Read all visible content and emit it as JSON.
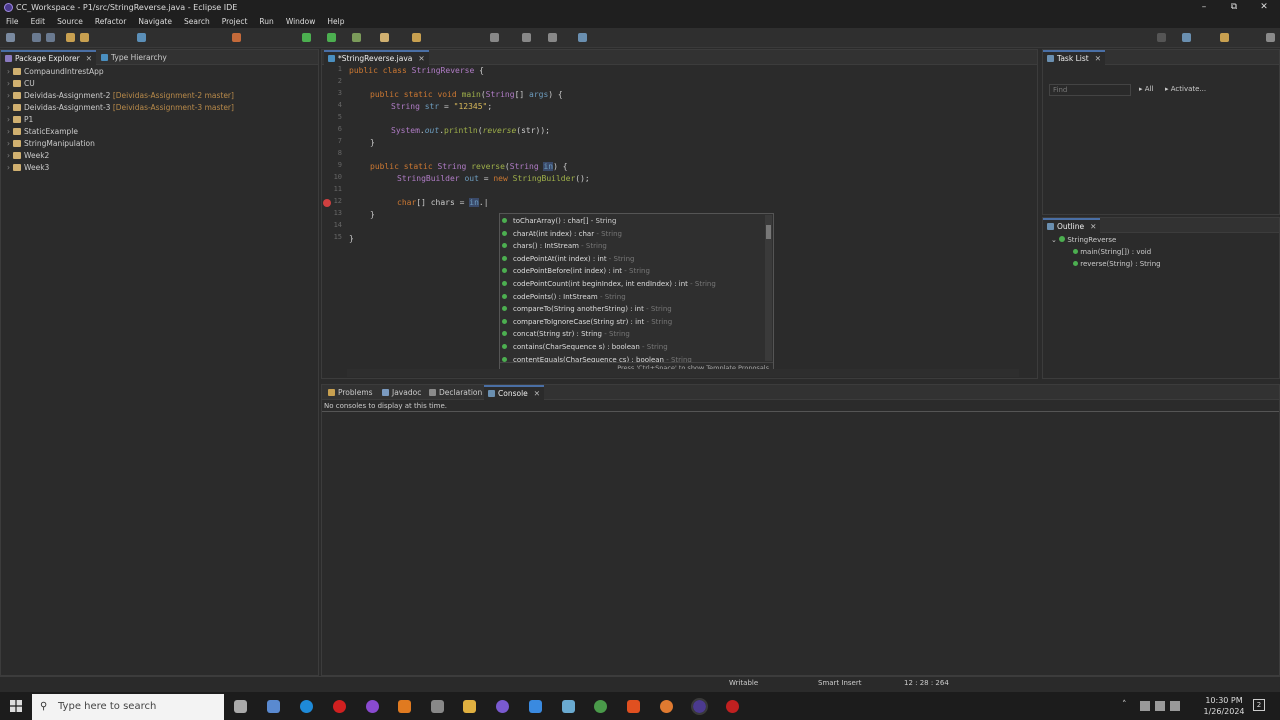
{
  "window": {
    "title": "CC_Workspace - P1/src/StringReverse.java - Eclipse IDE"
  },
  "menu": [
    "File",
    "Edit",
    "Source",
    "Refactor",
    "Navigate",
    "Search",
    "Project",
    "Run",
    "Window",
    "Help"
  ],
  "package_explorer": {
    "tabs": [
      "Package Explorer",
      "Type Hierarchy"
    ],
    "items": [
      {
        "label": "CompaundIntrestApp",
        "suffix": ""
      },
      {
        "label": "CU",
        "suffix": ""
      },
      {
        "label": "Deividas-Assignment-2",
        "suffix": " [Deividas-Assignment-2 master]"
      },
      {
        "label": "Deividas-Assignment-3",
        "suffix": " [Deividas-Assignment-3 master]"
      },
      {
        "label": "P1",
        "suffix": ""
      },
      {
        "label": "StaticExample",
        "suffix": ""
      },
      {
        "label": "StringManipulation",
        "suffix": ""
      },
      {
        "label": "Week2",
        "suffix": ""
      },
      {
        "label": "Week3",
        "suffix": ""
      }
    ]
  },
  "editor": {
    "tab": "*StringReverse.java",
    "line_numbers": [
      "1",
      "2",
      "3",
      "4",
      "5",
      "6",
      "7",
      "8",
      "9",
      "10",
      "11",
      "12",
      "13",
      "14",
      "15"
    ]
  },
  "autocomplete": {
    "items": [
      {
        "name": "toCharArray() : char[]",
        "src": " - String"
      },
      {
        "name": "charAt(int index) : char",
        "src": " - String"
      },
      {
        "name": "chars() : IntStream",
        "src": " - String"
      },
      {
        "name": "codePointAt(int index) : int",
        "src": " - String"
      },
      {
        "name": "codePointBefore(int index) : int",
        "src": " - String"
      },
      {
        "name": "codePointCount(int beginIndex, int endIndex) : int",
        "src": " - String"
      },
      {
        "name": "codePoints() : IntStream",
        "src": " - String"
      },
      {
        "name": "compareTo(String anotherString) : int",
        "src": " - String"
      },
      {
        "name": "compareToIgnoreCase(String str) : int",
        "src": " - String"
      },
      {
        "name": "concat(String str) : String",
        "src": " - String"
      },
      {
        "name": "contains(CharSequence s) : boolean",
        "src": " - String"
      },
      {
        "name": "contentEquals(CharSequence cs) : boolean",
        "src": " - String"
      }
    ],
    "footer": "Press 'Ctrl+Space' to show Template Proposals"
  },
  "task_list": {
    "tab": "Task List",
    "find_placeholder": "Find",
    "all": "All",
    "activate": "Activate..."
  },
  "outline": {
    "tab": "Outline",
    "root": "StringReverse",
    "items": [
      "main(String[]) : void",
      "reverse(String) : String"
    ]
  },
  "bottom": {
    "tabs": [
      "Problems",
      "Javadoc",
      "Declaration",
      "Console"
    ],
    "message": "No consoles to display at this time."
  },
  "status": {
    "writable": "Writable",
    "insert_mode": "Smart Insert",
    "position": "12 : 28 : 264"
  },
  "taskbar": {
    "search_placeholder": "Type here to search",
    "time": "10:30 PM",
    "date": "1/26/2024",
    "notification_count": "2"
  },
  "colors": {
    "keyword": "#cc7832",
    "string": "#d9b95a",
    "method": "#9fb04a",
    "accent": "#4a6fa5"
  }
}
